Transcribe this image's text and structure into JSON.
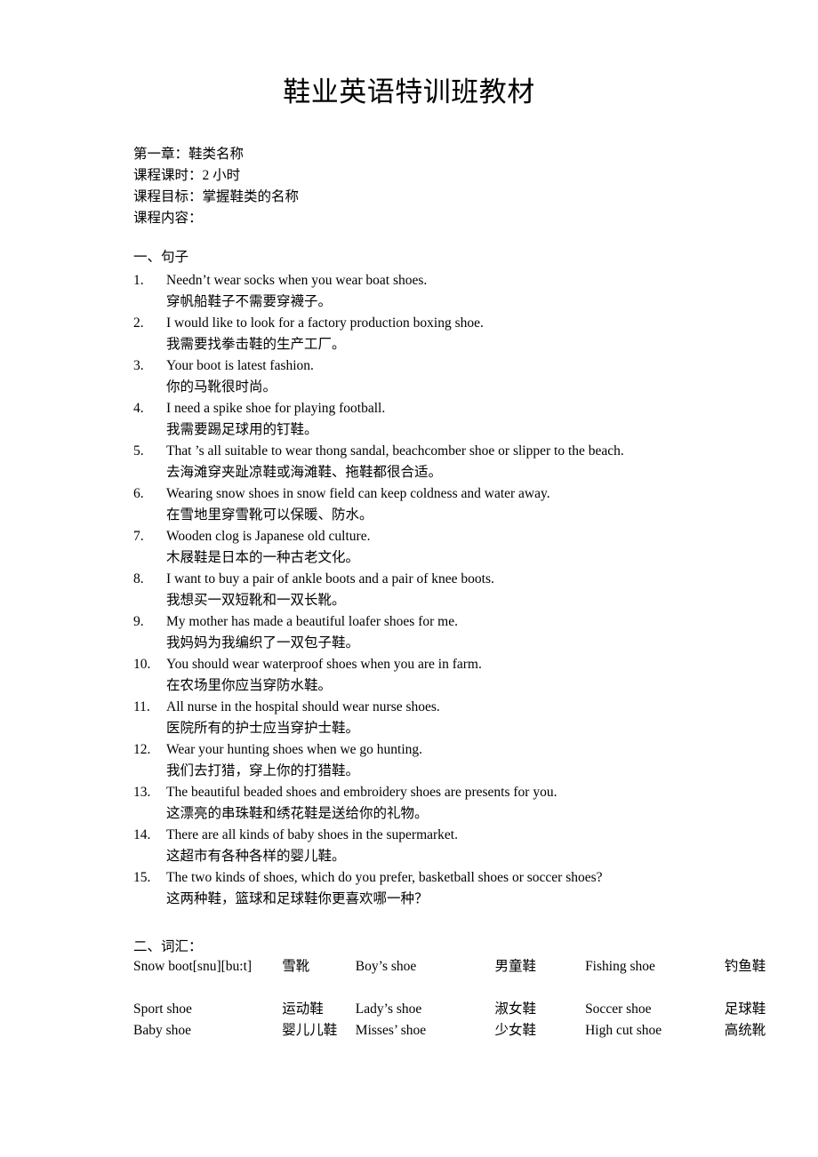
{
  "document": {
    "title": "鞋业英语特训班教材"
  },
  "header": {
    "lines": [
      "第一章：鞋类名称",
      "课程课时：2 小时",
      "课程目标：掌握鞋类的名称",
      "课程内容："
    ]
  },
  "sections": {
    "sentences_heading": "一、句子",
    "vocab_heading": "二、词汇："
  },
  "sentences": [
    {
      "num": "1.",
      "en": "Needn’t wear socks when you wear boat shoes.",
      "zh": "穿帆船鞋子不需要穿襪子。"
    },
    {
      "num": "2.",
      "en": "I would like to look for a factory production boxing shoe.",
      "zh": "我需要找拳击鞋的生产工厂。"
    },
    {
      "num": "3.",
      "en": "Your boot is latest fashion.",
      "zh": "你的马靴很时尚。"
    },
    {
      "num": "4.",
      "en": "I need a spike shoe for playing football.",
      "zh": "我需要踢足球用的钉鞋。"
    },
    {
      "num": "5.",
      "en": "That ’s all suitable to wear thong sandal, beachcomber shoe or slipper to the beach.",
      "zh": "去海滩穿夹趾凉鞋或海滩鞋、拖鞋都很合适。"
    },
    {
      "num": "6.",
      "en": "Wearing snow shoes in snow field can keep coldness and water away.",
      "zh": "在雪地里穿雪靴可以保暖、防水。"
    },
    {
      "num": "7.",
      "en": "Wooden clog is Japanese old culture.",
      "zh": "木屐鞋是日本的一种古老文化。"
    },
    {
      "num": "8.",
      "en": "I want to buy a pair of ankle boots and a pair of knee boots.",
      "zh": "我想买一双短靴和一双长靴。"
    },
    {
      "num": "9.",
      "en": "My mother has made a beautiful loafer shoes for me.",
      "zh": "我妈妈为我编织了一双包子鞋。"
    },
    {
      "num": "10.",
      "en": "You should wear waterproof shoes when you are in farm.",
      "zh": "在农场里你应当穿防水鞋。"
    },
    {
      "num": "11.",
      "en": "All nurse in the hospital should wear nurse shoes.",
      "zh": "医院所有的护士应当穿护士鞋。"
    },
    {
      "num": "12.",
      "en": "Wear your hunting shoes when we go hunting.",
      "zh": "我们去打猎，穿上你的打猎鞋。"
    },
    {
      "num": "13.",
      "en": "The beautiful beaded shoes and embroidery shoes are presents for you.",
      "zh": "这漂亮的串珠鞋和绣花鞋是送给你的礼物。"
    },
    {
      "num": "14.",
      "en": "There are all kinds of baby shoes in the supermarket.",
      "zh": "这超市有各种各样的婴儿鞋。"
    },
    {
      "num": "15.",
      "en": "The two kinds of shoes, which do you prefer, basketball shoes or soccer shoes?",
      "zh": "这两种鞋，篮球和足球鞋你更喜欢哪一种？"
    }
  ],
  "vocabulary": {
    "rows": [
      {
        "en1": "Snow   boot[snu][bu:t]",
        "zh1": "雪靴",
        "en2": "Boy’s shoe",
        "zh2": "男童鞋",
        "en3": "Fishing shoe",
        "zh3": "钓鱼鞋"
      },
      {
        "en1": "Sport shoe",
        "zh1": "运动鞋",
        "en2": "Lady’s shoe",
        "zh2": "淑女鞋",
        "en3": "Soccer shoe",
        "zh3": "足球鞋"
      },
      {
        "en1": "Baby shoe",
        "zh1": "婴儿儿鞋",
        "en2": "Misses’ shoe",
        "zh2": "少女鞋",
        "en3": "High cut shoe",
        "zh3": "高统靴"
      }
    ]
  }
}
